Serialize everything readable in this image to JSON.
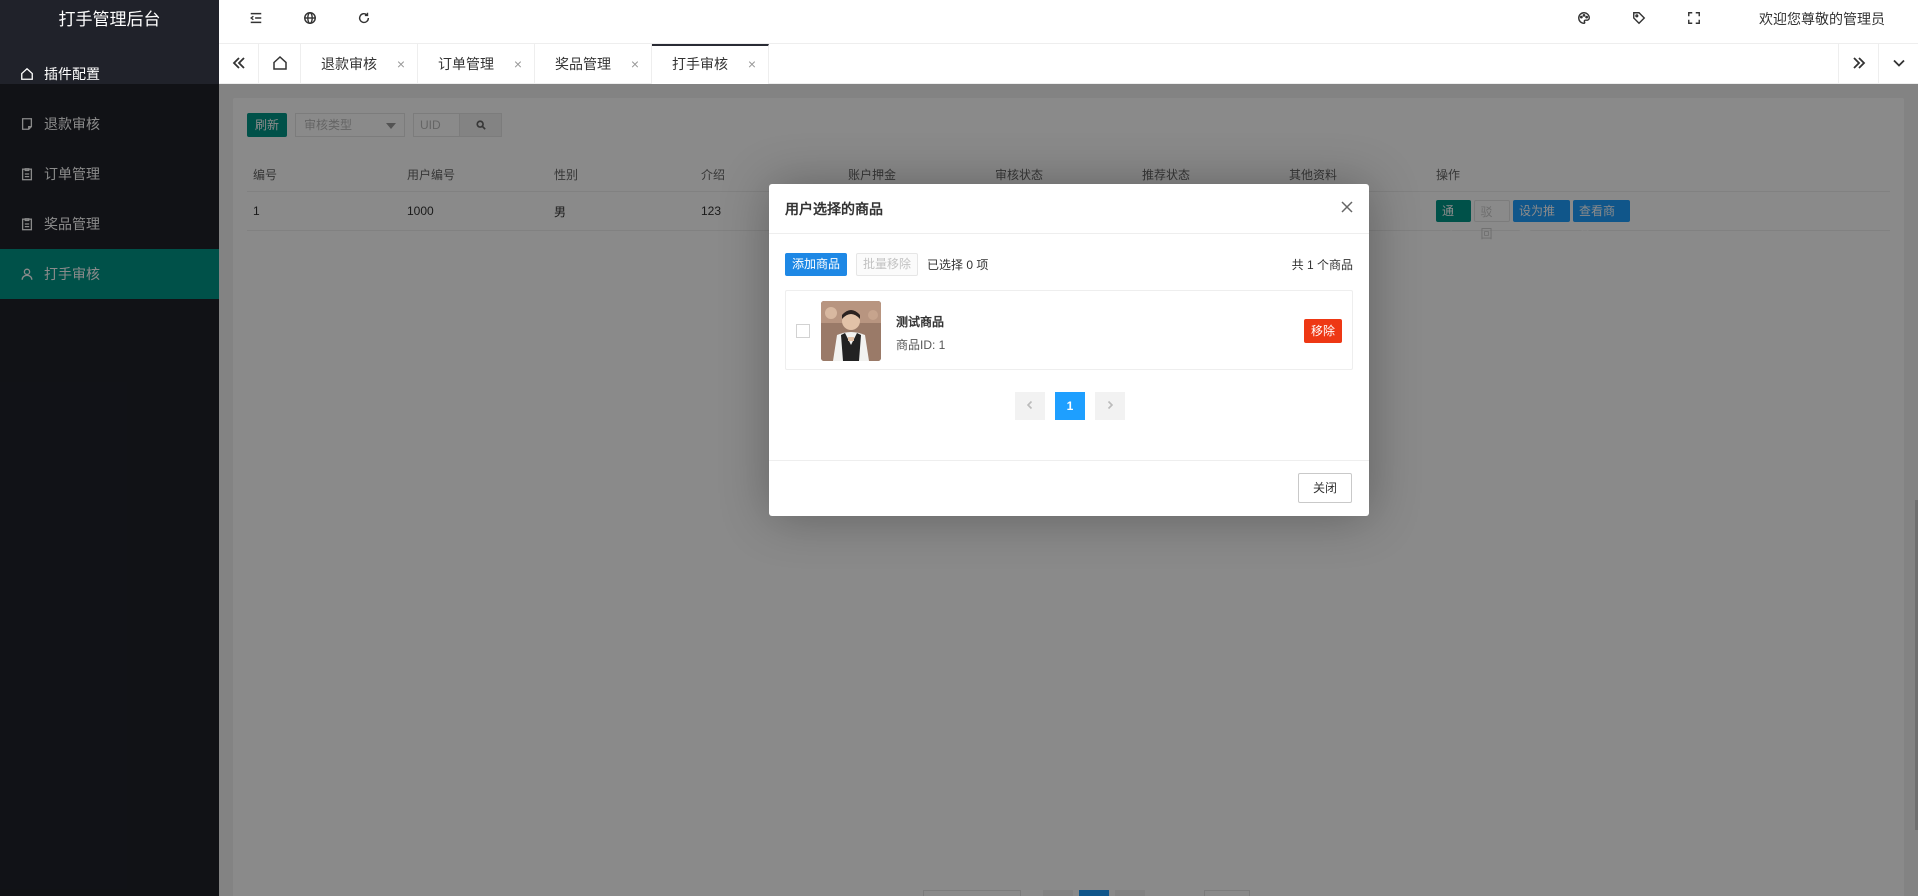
{
  "app": {
    "title": "打手管理后台",
    "welcome": "欢迎您尊敬的管理员"
  },
  "sidebar": {
    "items": [
      {
        "label": "插件配置",
        "icon": "home-icon",
        "active": false
      },
      {
        "label": "退款审核",
        "icon": "document-icon",
        "active": false
      },
      {
        "label": "订单管理",
        "icon": "clipboard-icon",
        "active": false
      },
      {
        "label": "奖品管理",
        "icon": "clipboard-icon",
        "active": false
      },
      {
        "label": "打手审核",
        "icon": "user-icon",
        "active": true
      }
    ]
  },
  "header": {
    "icons": [
      "menu-toggle-icon",
      "globe-icon",
      "refresh-icon",
      "theme-icon",
      "tag-icon",
      "fullscreen-icon"
    ]
  },
  "tabs": {
    "items": [
      {
        "label": "退款审核",
        "close": "×"
      },
      {
        "label": "订单管理",
        "close": "×"
      },
      {
        "label": "奖品管理",
        "close": "×"
      },
      {
        "label": "打手审核",
        "close": "×",
        "active": true
      }
    ]
  },
  "toolbar": {
    "refresh_label": "刷新",
    "select_placeholder": "审核类型",
    "uid_placeholder": "UID"
  },
  "table": {
    "columns": [
      "编号",
      "用户编号",
      "性别",
      "介绍",
      "账户押金",
      "审核状态",
      "推荐状态",
      "其他资料",
      "操作"
    ],
    "rows": [
      {
        "id": "1",
        "uid": "1000",
        "gender": "男",
        "intro": "123"
      }
    ],
    "actions": {
      "pass": "通过",
      "reject": "驳回",
      "recommend": "设为推荐",
      "view": "查看商品"
    }
  },
  "modal": {
    "title": "用户选择的商品",
    "add_label": "添加商品",
    "batch_remove_label": "批量移除",
    "selected_text": "已选择 0 项",
    "total_text": "共 1 个商品",
    "product": {
      "name": "测试商品",
      "id_text": "商品ID: 1",
      "remove_label": "移除"
    },
    "pager": {
      "current": "1"
    },
    "close_label": "关闭"
  },
  "colors": {
    "sidebar_bg": "#20222a",
    "active_green": "#009688",
    "primary_blue": "#1e9fff",
    "danger": "#ee3814"
  }
}
